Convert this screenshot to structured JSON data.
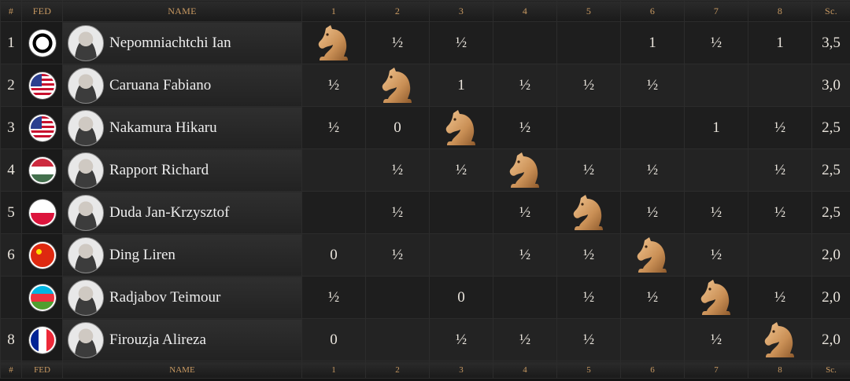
{
  "headers": {
    "rank": "#",
    "fed": "FED",
    "name": "NAME",
    "cols": [
      "1",
      "2",
      "3",
      "4",
      "5",
      "6",
      "7",
      "8"
    ],
    "score": "Sc."
  },
  "players": [
    {
      "rank": "1",
      "fed": "fide",
      "name": "Nepomniachtchi Ian",
      "results": [
        "self",
        "½",
        "½",
        "",
        "",
        "1",
        "½",
        "1"
      ],
      "score": "3,5"
    },
    {
      "rank": "2",
      "fed": "usa",
      "name": "Caruana Fabiano",
      "results": [
        "½",
        "self",
        "1",
        "½",
        "½",
        "½",
        "",
        ""
      ],
      "score": "3,0"
    },
    {
      "rank": "3",
      "fed": "usa",
      "name": "Nakamura Hikaru",
      "results": [
        "½",
        "0",
        "self",
        "½",
        "",
        "",
        "1",
        "½"
      ],
      "score": "2,5"
    },
    {
      "rank": "4",
      "fed": "hun",
      "name": "Rapport Richard",
      "results": [
        "",
        "½",
        "½",
        "self",
        "½",
        "½",
        "",
        "½"
      ],
      "score": "2,5"
    },
    {
      "rank": "5",
      "fed": "pol",
      "name": "Duda Jan-Krzysztof",
      "results": [
        "",
        "½",
        "",
        "½",
        "self",
        "½",
        "½",
        "½"
      ],
      "score": "2,5"
    },
    {
      "rank": "6",
      "fed": "chn",
      "name": "Ding Liren",
      "results": [
        "0",
        "½",
        "",
        "½",
        "½",
        "self",
        "½",
        ""
      ],
      "score": "2,0"
    },
    {
      "rank": "",
      "fed": "aze",
      "name": "Radjabov Teimour",
      "results": [
        "½",
        "",
        "0",
        "",
        "½",
        "½",
        "self",
        "½"
      ],
      "score": "2,0"
    },
    {
      "rank": "8",
      "fed": "fra",
      "name": "Firouzja Alireza",
      "results": [
        "0",
        "",
        "½",
        "½",
        "½",
        "",
        "½",
        "self"
      ],
      "score": "2,0"
    }
  ],
  "icons": {
    "self_cell": "knight-icon",
    "fed_fide": "fide-logo-icon"
  },
  "colors": {
    "header_text": "#c99a62",
    "knight": "#d8a46a"
  }
}
